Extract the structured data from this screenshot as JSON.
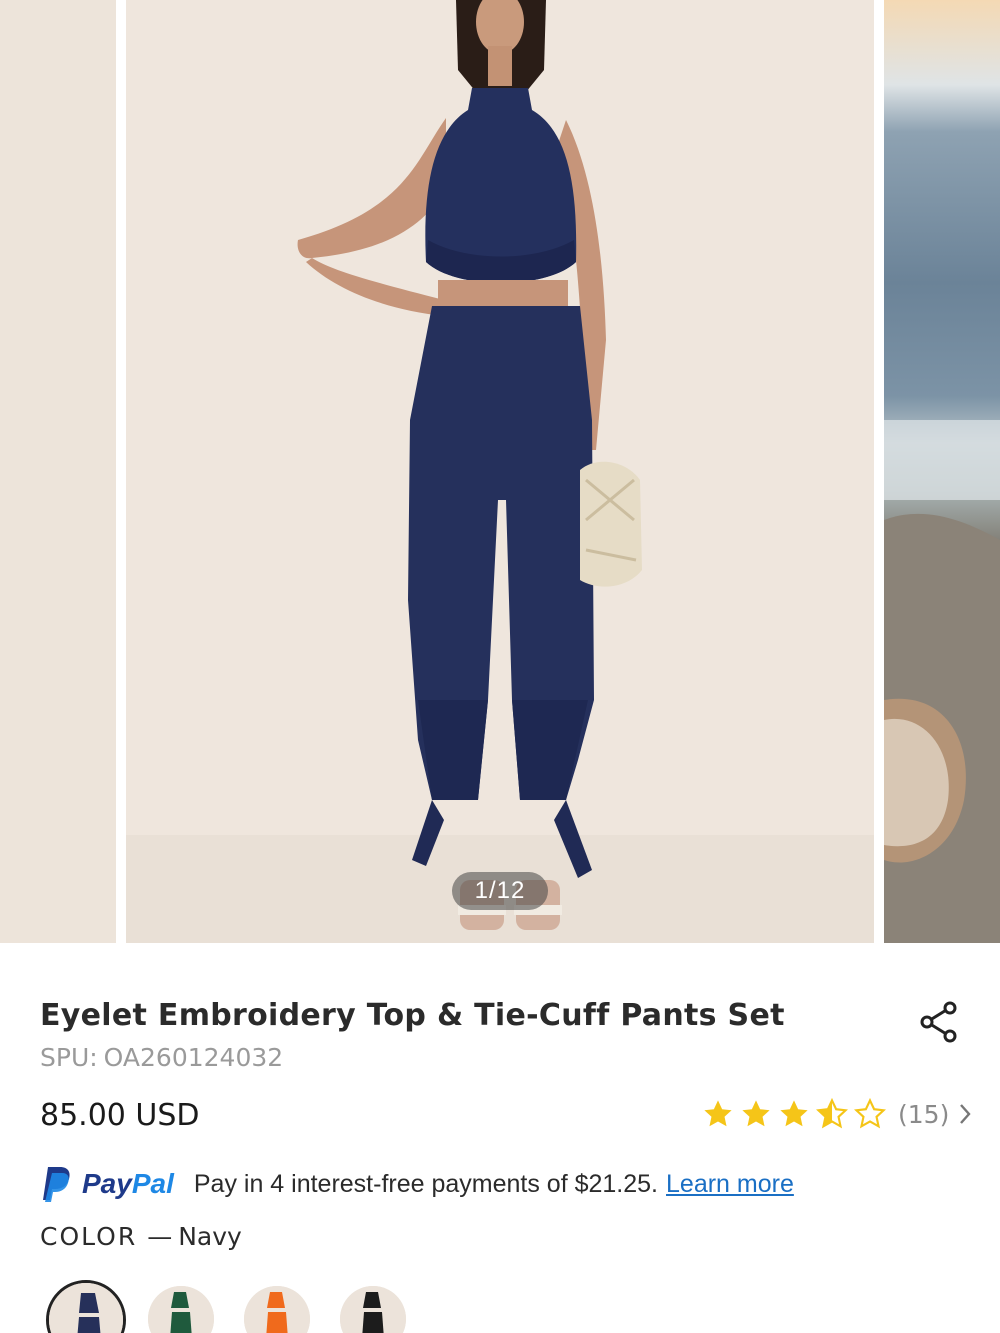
{
  "gallery": {
    "counter": "1/12"
  },
  "product": {
    "title": "Eyelet Embroidery Top & Tie-Cuff Pants Set",
    "spu_label": "SPU:",
    "spu_value": "OA260124032",
    "price": "85.00 USD",
    "rating": {
      "stars": 3.5,
      "max": 5,
      "count": "(15)",
      "star_color": "#f5c518"
    }
  },
  "paypal": {
    "brand_pay": "Pay",
    "brand_pal": "Pal",
    "text": "Pay in 4 interest-free payments of $21.25.",
    "link": "Learn more"
  },
  "color": {
    "label": "COLOR",
    "separator": "—",
    "value": "Navy",
    "swatches": [
      {
        "name": "navy",
        "color": "#26305a",
        "selected": true
      },
      {
        "name": "green",
        "color": "#1f5a3d",
        "selected": false
      },
      {
        "name": "orange",
        "color": "#f06a1c",
        "selected": false
      },
      {
        "name": "black",
        "color": "#1c1c1c",
        "selected": false
      }
    ]
  }
}
